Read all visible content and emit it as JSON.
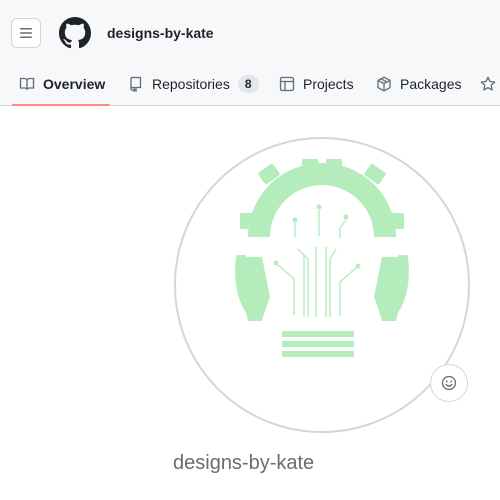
{
  "header": {
    "username": "designs-by-kate"
  },
  "tabs": [
    {
      "label": "Overview",
      "active": true,
      "icon": "book-icon"
    },
    {
      "label": "Repositories",
      "count": "8",
      "icon": "repo-icon"
    },
    {
      "label": "Projects",
      "icon": "table-icon"
    },
    {
      "label": "Packages",
      "icon": "package-icon"
    },
    {
      "label": "",
      "icon": "star-icon"
    }
  ],
  "profile": {
    "avatar_icon": "lightbulb-gear-logo",
    "avatar_color": "#b4ecbb",
    "display_name": "designs-by-kate",
    "status_icon": "smiley-icon"
  },
  "colors": {
    "accent_underline": "#fd8c73",
    "header_bg": "#f6f8fa"
  }
}
